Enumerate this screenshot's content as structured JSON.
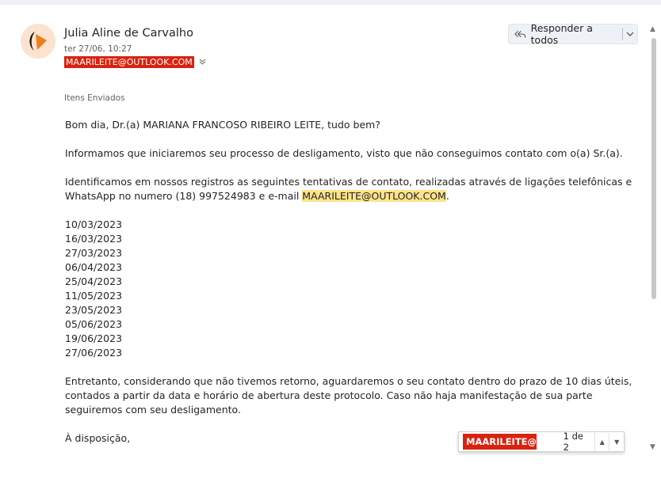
{
  "header": {
    "sender_name": "Julia Aline de Carvalho",
    "date": "ter 27/06, 10:27",
    "to_address": "MAARILEITE@OUTLOOK.COM",
    "reply_all_label": "Responder a todos"
  },
  "folder_label": "Itens Enviados",
  "email": {
    "greeting": "Bom dia, Dr.(a) MARIANA FRANCOSO RIBEIRO LEITE, tudo bem?",
    "para1": "Informamos que iniciaremos seu processo de desligamento, visto que não conseguimos contato com o(a) Sr.(a).",
    "para2_a": "Identificamos em nossos registros as seguintes tentativas de contato, realizadas através de ligações telefônicas e WhatsApp no numero (18) 997524983 e e-mail ",
    "para2_email": "MAARILEITE@OUTLOOK.COM",
    "para2_end": ".",
    "dates": [
      "10/03/2023",
      "16/03/2023",
      "27/03/2023",
      "06/04/2023",
      "25/04/2023",
      "11/05/2023",
      "23/05/2023",
      "05/06/2023",
      "19/06/2023",
      "27/06/2023"
    ],
    "para3": "Entretanto, considerando que não tivemos retorno, aguardaremos o seu contato dentro do prazo de 10 dias úteis, contados a partir da data e horário de abertura deste protocolo. Caso não haja manifestação de sua parte seguiremos com seu desligamento.",
    "closing": "À disposição,"
  },
  "find_bar": {
    "query": "MAARILEITE@...",
    "count": "1 de 2"
  },
  "colors": {
    "highlight": "#fde38a",
    "selection_red": "#d9230f"
  }
}
